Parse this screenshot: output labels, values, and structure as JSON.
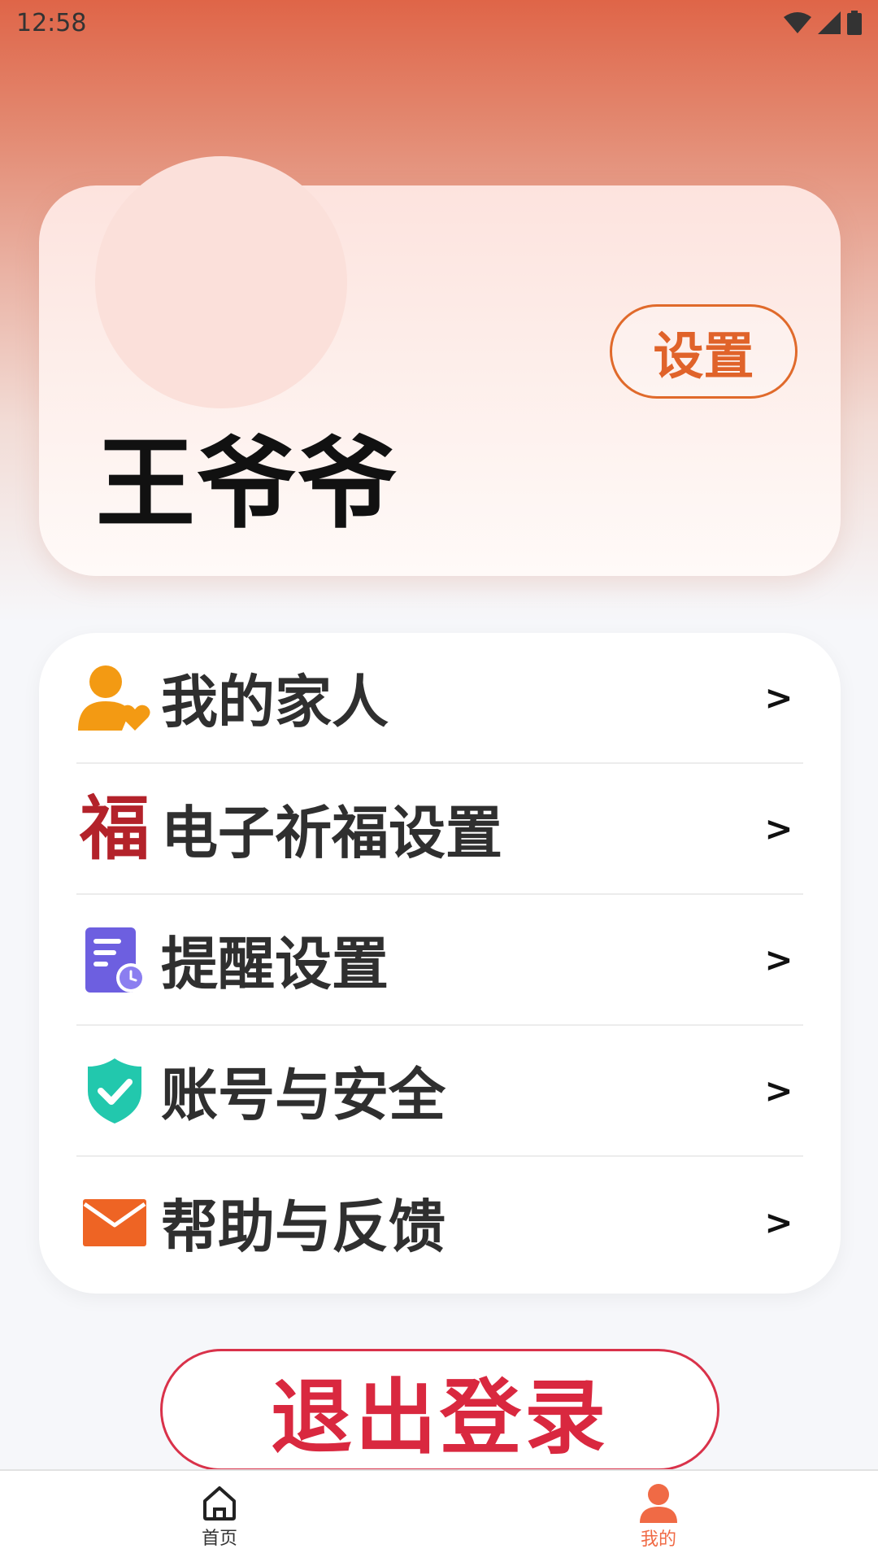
{
  "status_bar": {
    "time": "12:58"
  },
  "profile": {
    "name": "王爷爷",
    "settings_label": "设置"
  },
  "menu": [
    {
      "label": "我的家人",
      "arrow": ">",
      "icon": "family-heart-icon"
    },
    {
      "label": "电子祈福设置",
      "arrow": ">",
      "icon": "fu-blessing-icon"
    },
    {
      "label": "提醒设置",
      "arrow": ">",
      "icon": "reminder-document-clock-icon"
    },
    {
      "label": "账号与安全",
      "arrow": ">",
      "icon": "shield-check-icon"
    },
    {
      "label": "帮助与反馈",
      "arrow": ">",
      "icon": "envelope-icon"
    }
  ],
  "fu_glyph": "福",
  "logout_label": "退出登录",
  "tabs": [
    {
      "label": "首页",
      "icon": "home-icon",
      "active": false
    },
    {
      "label": "我的",
      "icon": "person-icon",
      "active": true
    }
  ],
  "colors": {
    "accent": "#e0632a",
    "logout_red": "#d9283f",
    "tab_active": "#f06a45"
  }
}
